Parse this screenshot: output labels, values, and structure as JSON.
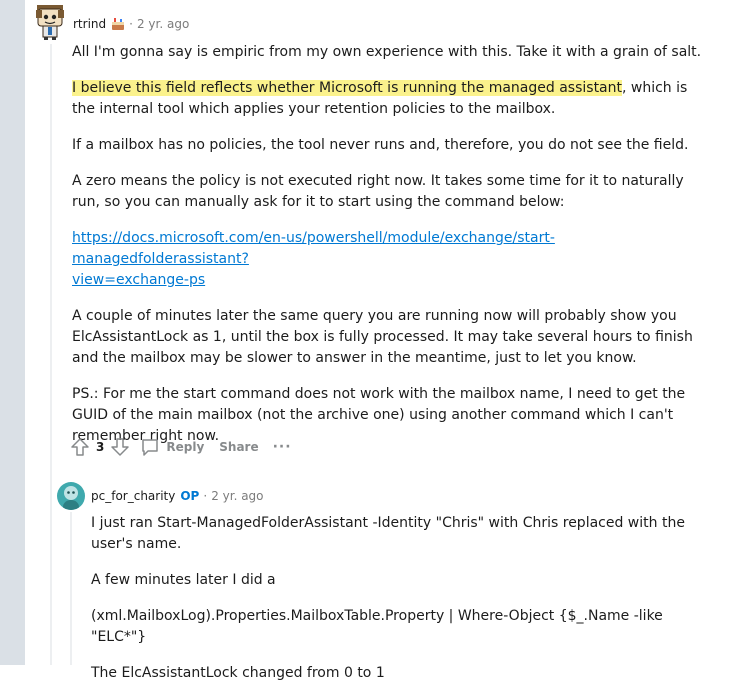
{
  "comment1": {
    "username": "rtrind",
    "time": "2 yr. ago",
    "paragraphs": {
      "p1": "All I'm gonna say is empiric from my own experience with this. Take it with a grain of salt.",
      "p2_highlight": "I believe this field reflects whether Microsoft is running the managed assistant",
      "p2_rest": ", which is the internal tool which applies your retention policies to the mailbox.",
      "p3": "If a mailbox has no policies, the tool never runs and, therefore, you do not see the field.",
      "p4": "A zero means the policy is not executed right now. It takes some time for it to naturally run, so you can manually ask for it to start using the command below:",
      "link_line1": "https://docs.microsoft.com/en-us/powershell/module/exchange/start-managedfolderassistant?",
      "link_line2": "view=exchange-ps",
      "p5": "A couple of minutes later the same query you are running now will probably show you ElcAssistantLock as 1, until the box is fully processed. It may take several hours to finish and the mailbox may be slower to answer in the meantime, just to let you know.",
      "p6": "PS.: For me the start command does not work with the mailbox name, I need to get the GUID of the main mailbox (not the archive one) using another command which I can't remember right now."
    },
    "actions": {
      "vote_count": "3",
      "reply": "Reply",
      "share": "Share",
      "more": "···"
    }
  },
  "comment2": {
    "username": "pc_for_charity",
    "op_badge": "OP",
    "time": "2 yr. ago",
    "paragraphs": {
      "p1": "I just ran Start-ManagedFolderAssistant -Identity \"Chris\" with Chris replaced with the user's name.",
      "p2": "A few minutes later I did a",
      "p3": "(xml.MailboxLog).Properties.MailboxTable.Property | Where-Object {$_.Name -like \"ELC*\"}",
      "p4": "The ElcAssistantLock changed from 0 to 1"
    }
  },
  "colors": {
    "highlight": "#fbf28c",
    "link": "#0079d3",
    "op": "#0079d3",
    "rail": "#dae0e6"
  }
}
